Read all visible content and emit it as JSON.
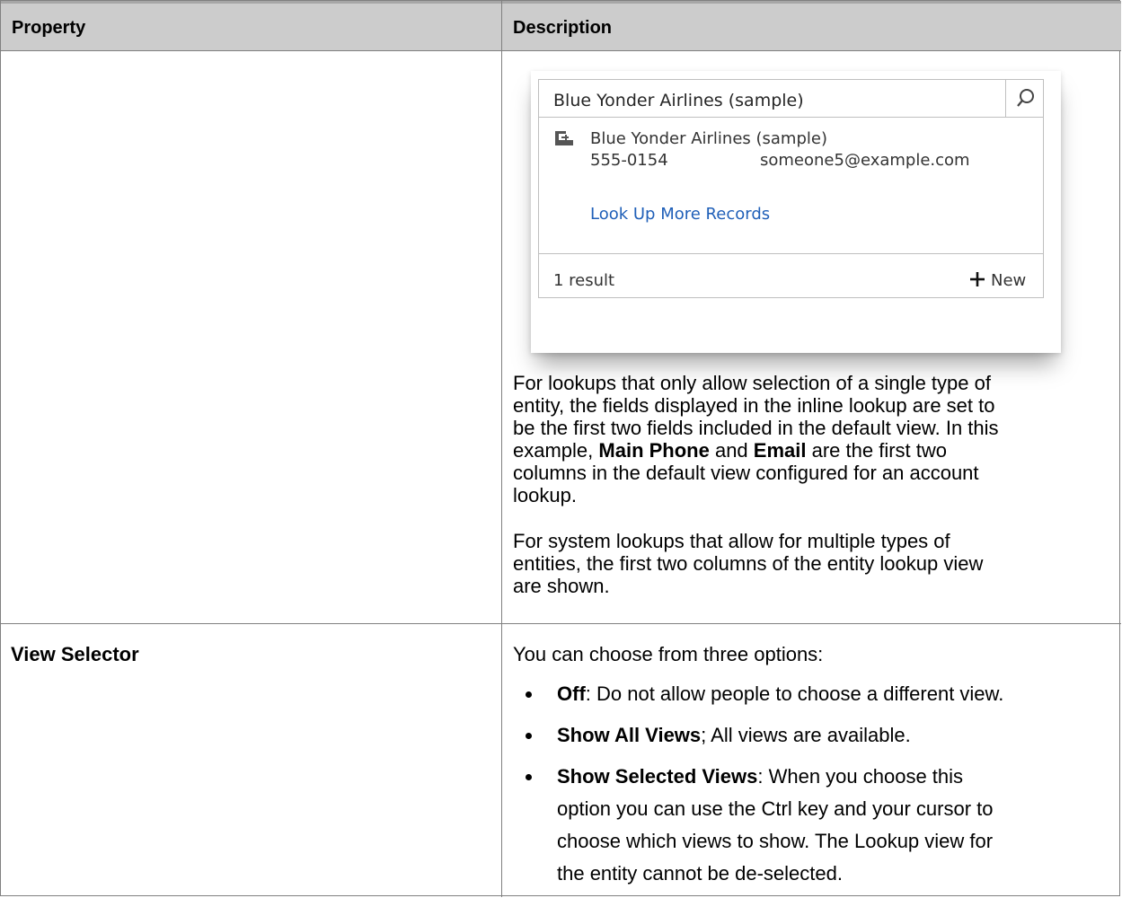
{
  "table": {
    "headers": {
      "property": "Property",
      "description": "Description"
    }
  },
  "lookup": {
    "input_value": "Blue Yonder Airlines (sample)",
    "result": {
      "name": "Blue Yonder Airlines (sample)",
      "phone": "555-0154",
      "email": "someone5@example.com"
    },
    "look_up_more": "Look Up More Records",
    "result_count": "1 result",
    "new_label": "New"
  },
  "description_row1": {
    "para1_lines": [
      "For lookups that only allow selection of a single type of",
      "entity, the fields displayed in the inline lookup are set to",
      "be the first two fields included in the default view. In this"
    ],
    "para1_line4": {
      "pre": "example, ",
      "b1": "Main Phone",
      "mid": " and ",
      "b2": "Email",
      "post": " are the first two"
    },
    "para1_lines_end": [
      "columns in the default view configured for an account",
      "lookup."
    ],
    "para2_lines": [
      "For system lookups that allow for multiple types of",
      "entities, the first two columns of the entity lookup view",
      "are shown."
    ]
  },
  "row2": {
    "property": "View Selector",
    "intro": "You can choose from three options:",
    "bullets": [
      {
        "bold": "Off",
        "rest": ": Do not allow people to choose a different view."
      },
      {
        "bold": "Show All Views",
        "rest": "; All views are available."
      },
      {
        "bold": "Show Selected Views",
        "rest": ": When you choose this"
      }
    ],
    "bullet3_cont": [
      "option you can use the Ctrl key and your cursor to",
      "choose which views to show. The Lookup view for",
      "the entity cannot be de-selected."
    ]
  }
}
